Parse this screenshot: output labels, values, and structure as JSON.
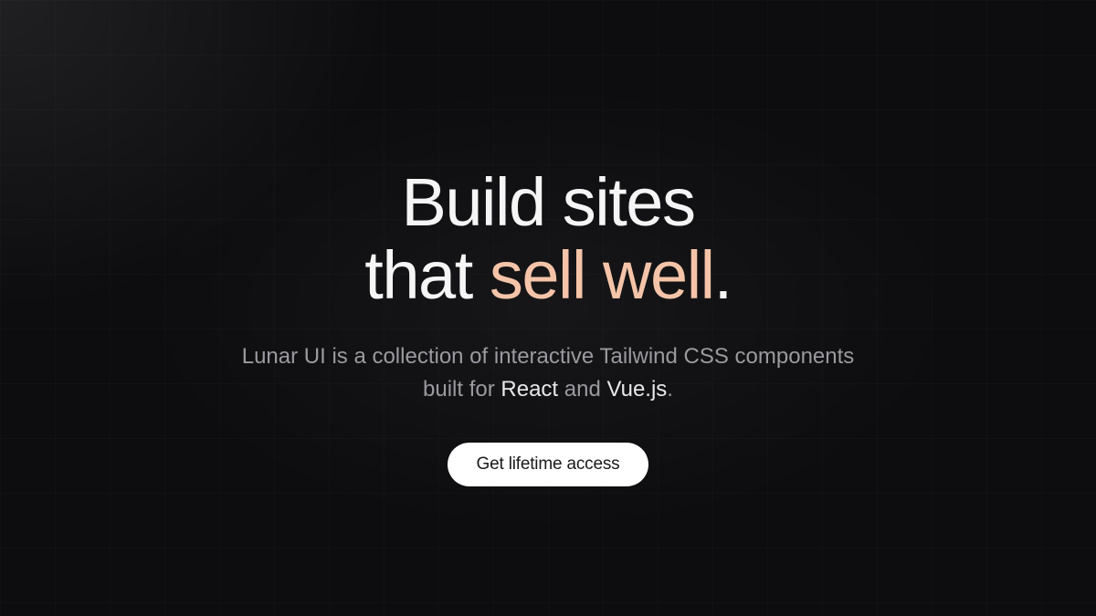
{
  "hero": {
    "headline_line1": "Build sites",
    "headline_line2_prefix": "that ",
    "headline_line2_accent": "sell well",
    "headline_line2_suffix": ".",
    "subheadline_pre": "Lunar UI is a collection of interactive Tailwind CSS components built for ",
    "subheadline_bold1": "React",
    "subheadline_mid": " and ",
    "subheadline_bold2": "Vue.js",
    "subheadline_suffix": "."
  },
  "cta": {
    "label": "Get lifetime access"
  },
  "colors": {
    "background": "#0d0d0f",
    "foreground": "#f5f5f5",
    "accent": "#f5c4a8",
    "muted": "#9a9a9f",
    "button_bg": "#ffffff",
    "button_fg": "#1a1a1a"
  }
}
